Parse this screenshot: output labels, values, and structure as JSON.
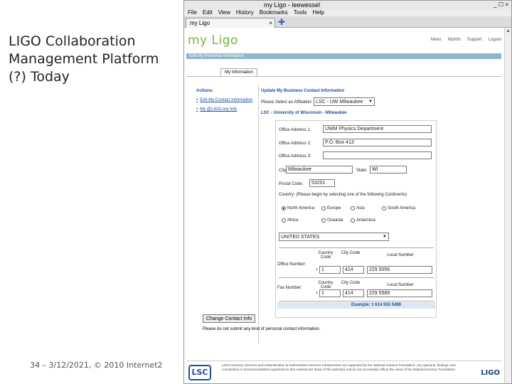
{
  "slide": {
    "title": "LIGO Collaboration Management Platform (?) Today",
    "footer": "34 – 3/12/2021, © 2010 Internet2"
  },
  "browser": {
    "window_title": "my Ligo - leewessel",
    "menu": [
      "File",
      "Edit",
      "View",
      "History",
      "Bookmarks",
      "Tools",
      "Help"
    ],
    "tab_label": "my Ligo",
    "new_tab_symbol": "✚",
    "close_symbol": "×",
    "window_controls": "_ ☐ ×"
  },
  "page": {
    "logo": "my Ligo",
    "nav": [
      "News",
      "MyInfo",
      "Support",
      "Logout"
    ],
    "section_bar": "Edit My Personal Information",
    "subtab": "My Information",
    "actions": {
      "heading": "Actions:",
      "items": [
        "Edit My Contact Information",
        "My @LIGO.org Info"
      ]
    },
    "form": {
      "heading": "Update My Business Contact Information",
      "affiliation_label": "Please Select an Affiliation:",
      "affiliation_value": "LSC - UW Milwaukee",
      "institution": "LSC - University of Wisconsin - Milwaukee",
      "office1_label": "Office Address 1:",
      "office1_value": "UWM Physics Department",
      "office2_label": "Office Address 2:",
      "office2_value": "P.O. Box 413",
      "office3_label": "Office Address 3:",
      "office3_value": "",
      "city_label": "City:",
      "city_value": "Milwaukee",
      "state_label": "State:",
      "state_value": "WI",
      "postal_label": "Postal Code:",
      "postal_value": "53201",
      "country_prompt": "Country: (Please begin by selecting one of the following Continents)",
      "continents": [
        "North America",
        "Europe",
        "Asia",
        "South America",
        "Africa",
        "Oceania",
        "Antarctica"
      ],
      "selected_continent": "North America",
      "country_value": "UNITED STATES",
      "col_country": "Country Code",
      "col_city": "City Code",
      "col_local": "Local Number",
      "office_number_label": "Office Number:",
      "fax_number_label": "Fax Number:",
      "plus": "+",
      "office_country": "1",
      "office_city": "414",
      "office_local": "229 5056",
      "fax_country": "1",
      "fax_city": "414",
      "fax_local": "229 5589",
      "example": "Example: 1 614 555 5489",
      "button": "Change Contact Info",
      "note": "Please do not submit any kind of personal contact information."
    },
    "footer_text": "LIGO Directory Services and Authentication & Authorization Services Infrastructure are supported by the National Science Foundation. Any opinions, findings, and conclusions or recommendations expressed in this material are those of the author(s) and do not necessarily reflect the views of the National Science Foundation.",
    "lsc_logo": "LSC",
    "ligo_logo": "LIGO"
  }
}
